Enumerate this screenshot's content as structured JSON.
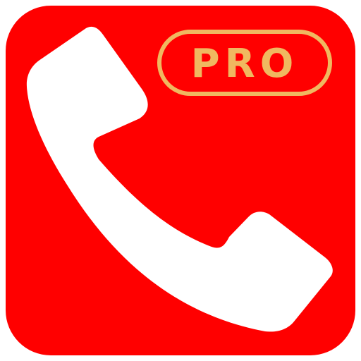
{
  "icon": {
    "name": "phone-pro-app-icon",
    "glyph": "phone-handset-icon",
    "badge_text": "PRO",
    "background_color": "#ff0000",
    "glyph_color": "#ffffff",
    "badge_color": "#f0b860"
  }
}
